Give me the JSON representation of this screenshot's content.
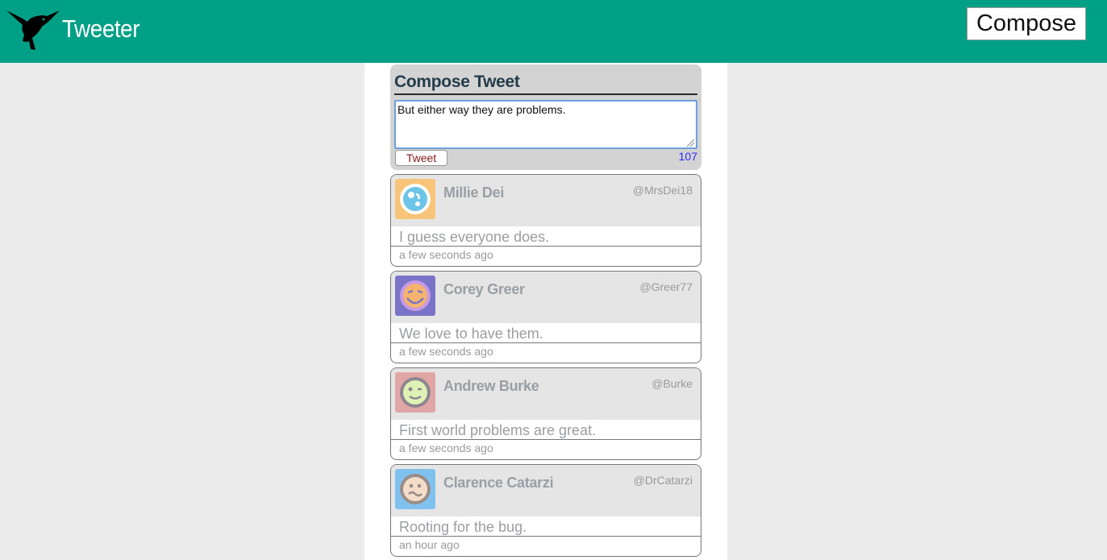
{
  "app": {
    "title": "Tweeter",
    "logo_icon": "hummingbird-icon"
  },
  "nav": {
    "compose_label": "Compose"
  },
  "compose": {
    "title": "Compose Tweet",
    "textarea_value": "But either way they are problems.",
    "tweet_button_label": "Tweet",
    "char_counter": "107"
  },
  "tweets": [
    {
      "name": "Millie Dei",
      "handle": "@MrsDei18",
      "text": "I guess everyone does.",
      "time": "a few seconds ago",
      "avatar_icon": "avatar-planet-icon",
      "avatar_bg": "#f7c47a"
    },
    {
      "name": "Corey Greer",
      "handle": "@Greer77",
      "text": "We love to have them.",
      "time": "a few seconds ago",
      "avatar_icon": "avatar-grin-icon",
      "avatar_bg": "#7a74c9"
    },
    {
      "name": "Andrew Burke",
      "handle": "@Burke",
      "text": "First world problems are great.",
      "time": "a few seconds ago",
      "avatar_icon": "avatar-wink-icon",
      "avatar_bg": "#e1a6a6"
    },
    {
      "name": "Clarence Catarzi",
      "handle": "@DrCatarzi",
      "text": "Rooting for the bug.",
      "time": "an hour ago",
      "avatar_icon": "avatar-wavy-mouth-icon",
      "avatar_bg": "#7fc2ef"
    }
  ],
  "colors": {
    "nav_bg": "#00a087",
    "compose_bg": "#d3d3d3",
    "counter": "#2a2aff",
    "tweet_button_text": "#8b1a1a"
  }
}
